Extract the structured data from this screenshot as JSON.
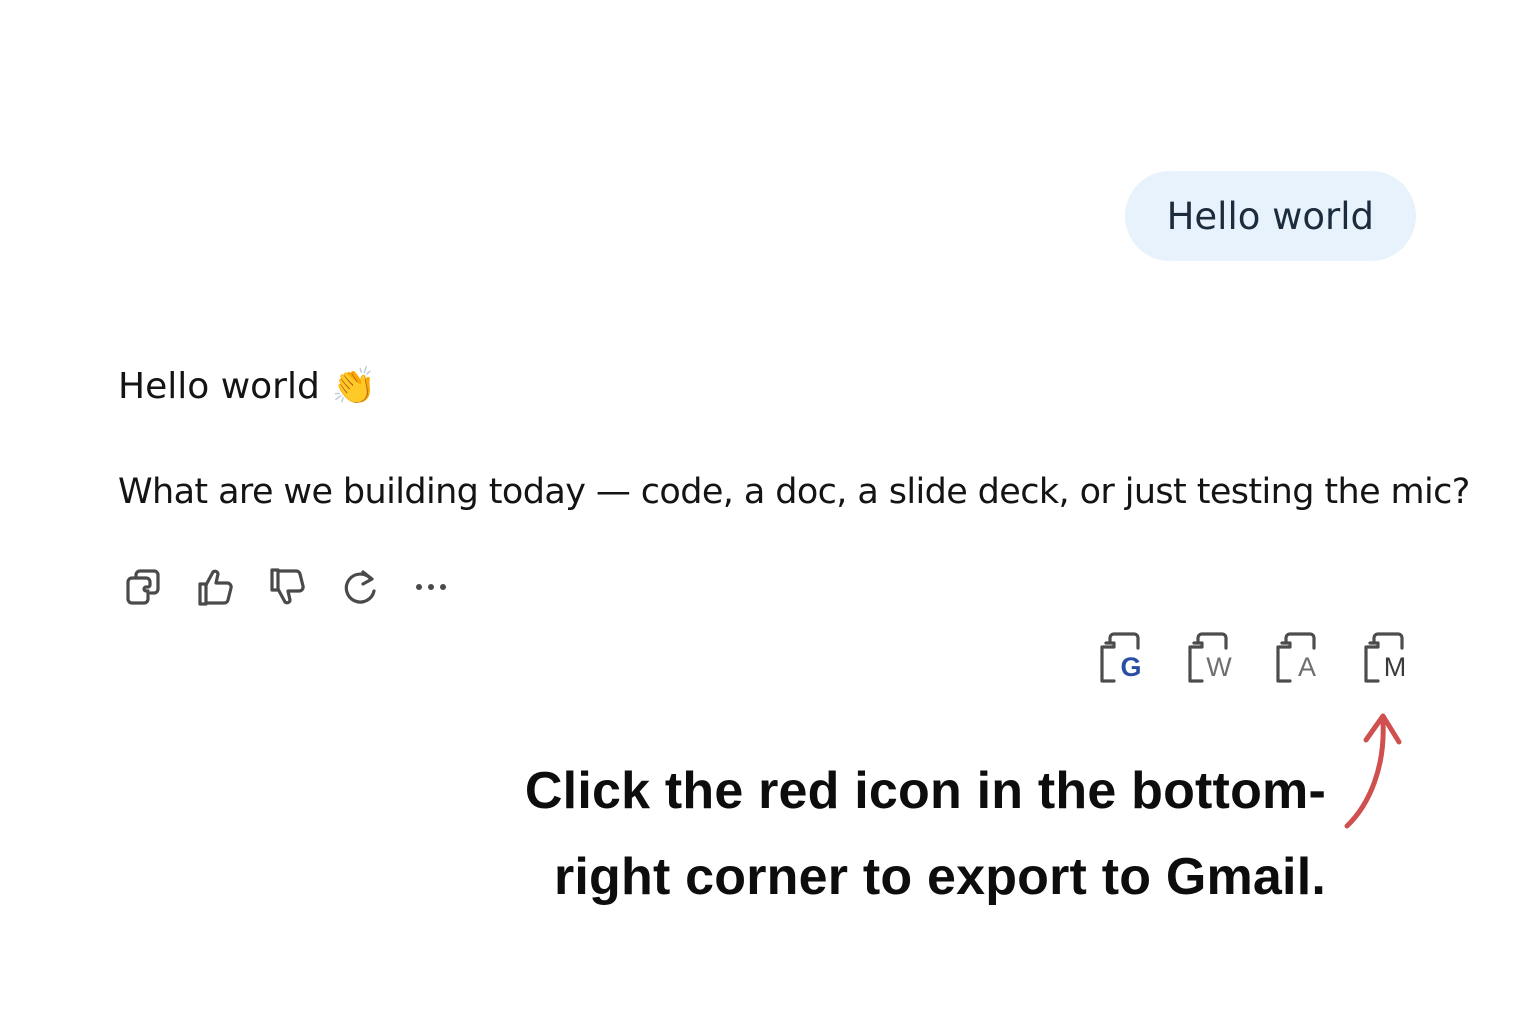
{
  "user_message": {
    "text": "Hello world"
  },
  "assistant_message": {
    "greeting": "Hello world",
    "emoji": "👏",
    "question": "What are we building today — code, a doc, a slide deck, or just testing the mic?"
  },
  "message_actions": [
    {
      "name": "copy",
      "icon": "copy-icon"
    },
    {
      "name": "thumbs-up",
      "icon": "thumbs-up-icon"
    },
    {
      "name": "thumbs-down",
      "icon": "thumbs-down-icon"
    },
    {
      "name": "regenerate",
      "icon": "refresh-icon"
    },
    {
      "name": "more",
      "icon": "more-icon"
    }
  ],
  "export_options": [
    {
      "name": "google-docs",
      "letter": "G",
      "letter_color": "#2a4ea3"
    },
    {
      "name": "word",
      "letter": "W",
      "letter_color": "#6f6f6f"
    },
    {
      "name": "acrobat",
      "letter": "A",
      "letter_color": "#6f6f6f"
    },
    {
      "name": "gmail",
      "letter": "M",
      "letter_color": "#3a3a3a"
    }
  ],
  "annotation": {
    "line1": "Click the red icon in the bottom-",
    "line2": "right corner to export to Gmail.",
    "arrow_color": "#d05050"
  }
}
